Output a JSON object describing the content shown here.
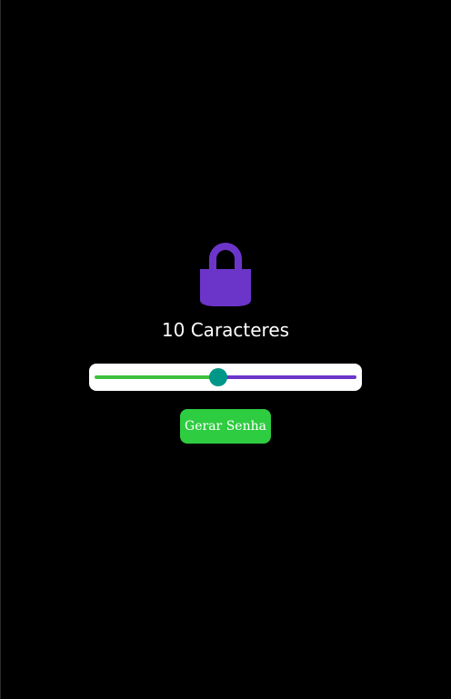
{
  "colors": {
    "background": "#000000",
    "accent_purple": "#6c35c9",
    "accent_green": "#2ecc40",
    "slider_left_green": "#3fbf3f",
    "slider_thumb": "#009688",
    "white": "#ffffff"
  },
  "icon": {
    "name": "lock-icon"
  },
  "length_label": {
    "count": "10",
    "suffix": "Caracteres"
  },
  "slider": {
    "min": 1,
    "max": 20,
    "value": 10
  },
  "button": {
    "label": "Gerar Senha"
  }
}
